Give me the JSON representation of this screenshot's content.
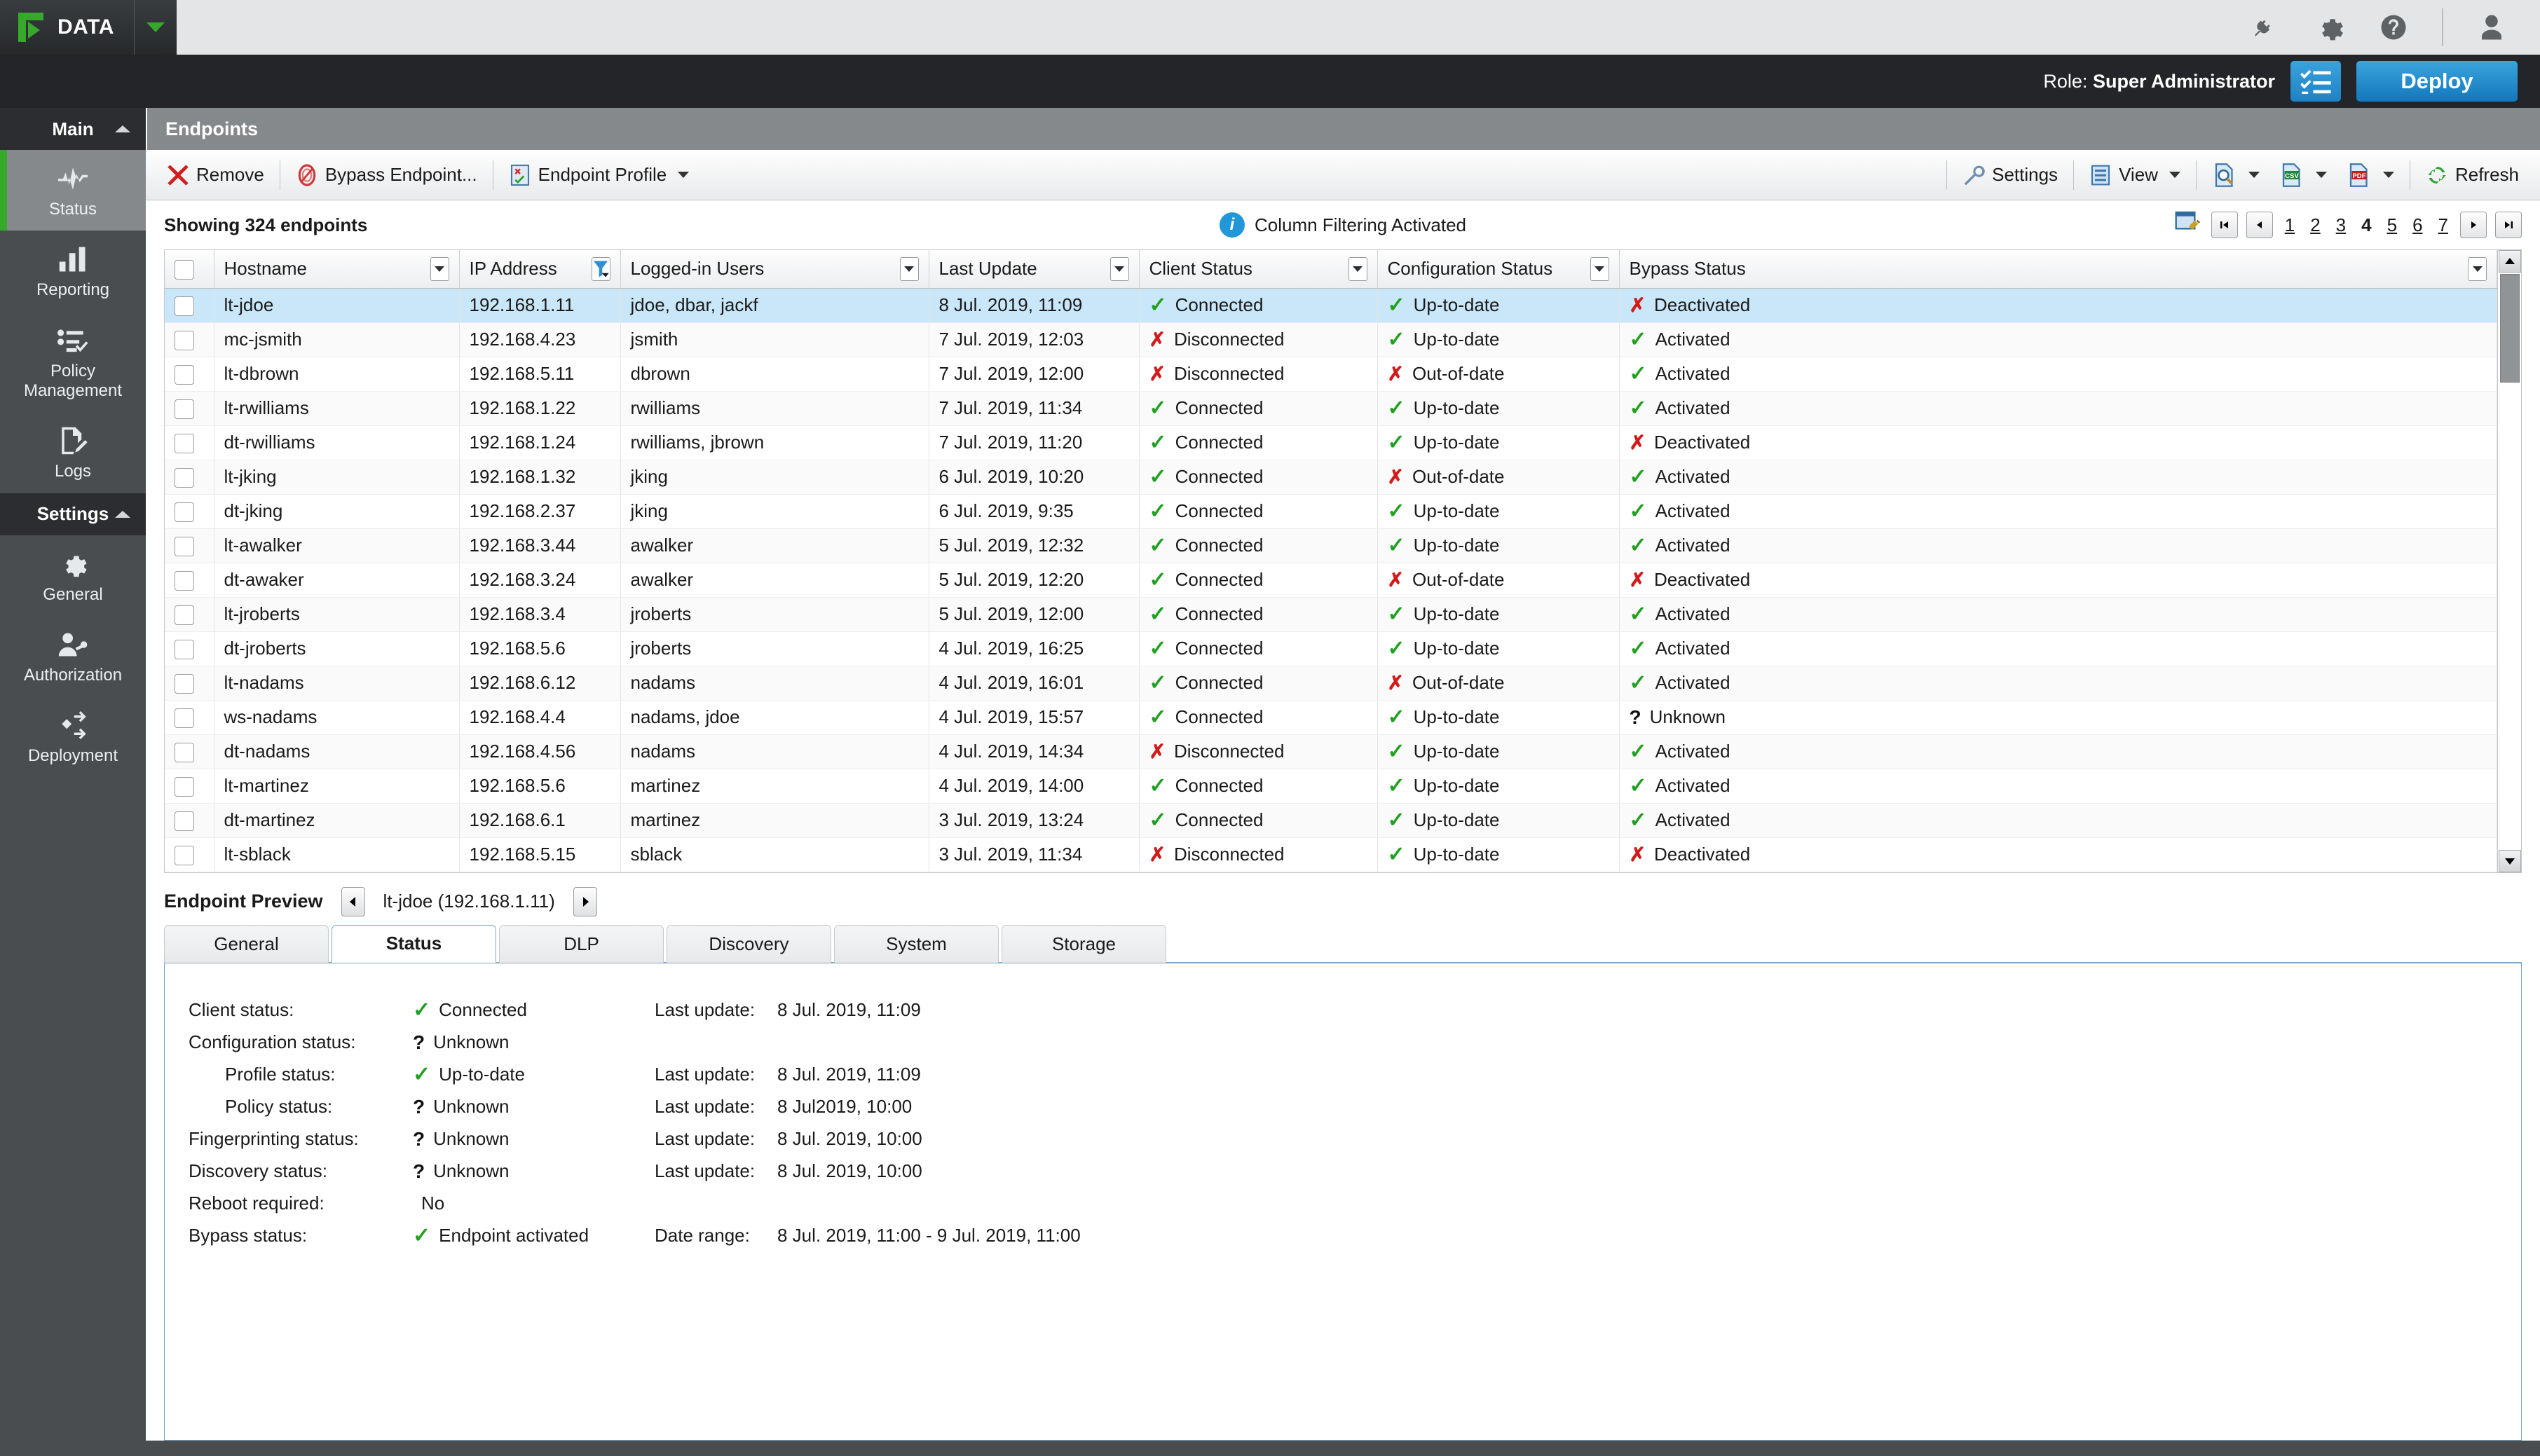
{
  "brand": {
    "name": "DATA",
    "logo_icon": "play-corner-logo",
    "caret_icon": "chevron-down-icon"
  },
  "topbar_icons": [
    {
      "name": "plugin-icon",
      "label": "Plugins"
    },
    {
      "name": "gear-icon",
      "label": "Settings"
    },
    {
      "name": "help-icon",
      "label": "Help"
    },
    {
      "name": "user-icon",
      "label": "Account"
    }
  ],
  "rolebar": {
    "role_prefix": "Role:",
    "role_value": "Super Administrator",
    "tasks_icon": "checklist-icon",
    "deploy_label": "Deploy",
    "accent": "#1d82c4"
  },
  "sidebar": {
    "groups": [
      {
        "label": "Main",
        "collapse_icon": "chevron-up-icon",
        "items": [
          {
            "label": "Status",
            "icon": "pulse-icon",
            "active": true
          },
          {
            "label": "Reporting",
            "icon": "bar-chart-icon",
            "active": false
          },
          {
            "label": "Policy Management",
            "icon": "checklist-icon",
            "active": false
          },
          {
            "label": "Logs",
            "icon": "document-pencil-icon",
            "active": false
          }
        ]
      },
      {
        "label": "Settings",
        "collapse_icon": "chevron-up-icon",
        "items": [
          {
            "label": "General",
            "icon": "gear-icon",
            "active": false
          },
          {
            "label": "Authorization",
            "icon": "user-key-icon",
            "active": false
          },
          {
            "label": "Deployment",
            "icon": "deployment-nodes-icon",
            "active": false
          }
        ]
      }
    ],
    "active_accent": "#36a82b"
  },
  "page": {
    "title": "Endpoints"
  },
  "toolbar": {
    "left": [
      {
        "label": "Remove",
        "icon": "red-x-icon"
      },
      {
        "label": "Bypass Endpoint...",
        "icon": "no-entry-icon"
      },
      {
        "label": "Endpoint Profile",
        "icon": "profile-doc-icon",
        "caret": true
      }
    ],
    "right": [
      {
        "label": "Settings",
        "icon": "wrench-icon"
      },
      {
        "label": "View",
        "icon": "list-view-icon",
        "caret": true
      },
      {
        "label": "",
        "icon": "preview-search-icon",
        "caret": true
      },
      {
        "label": "",
        "icon": "csv-export-icon",
        "caret": true
      },
      {
        "label": "",
        "icon": "pdf-export-icon",
        "caret": true
      },
      {
        "label": "Refresh",
        "icon": "refresh-icon"
      }
    ]
  },
  "info_row": {
    "showing": "Showing 324 endpoints",
    "column_filter_notice": "Column Filtering Activated",
    "info_icon": "info-icon",
    "grid_settings_icon": "grid-settings-icon"
  },
  "pagination": {
    "first_icon": "first-page-icon",
    "prev_icon": "prev-page-icon",
    "next_icon": "next-page-icon",
    "last_icon": "last-page-icon",
    "pages": [
      "1",
      "2",
      "3",
      "4",
      "5",
      "6",
      "7"
    ],
    "current": "4"
  },
  "table": {
    "columns": [
      {
        "key": "check",
        "label": "",
        "filter": "none"
      },
      {
        "key": "host",
        "label": "Hostname",
        "filter": "dropdown"
      },
      {
        "key": "ip",
        "label": "IP Address",
        "filter": "funnel-active"
      },
      {
        "key": "users",
        "label": "Logged-in Users",
        "filter": "dropdown"
      },
      {
        "key": "update",
        "label": "Last Update",
        "filter": "dropdown"
      },
      {
        "key": "client",
        "label": "Client Status",
        "filter": "dropdown"
      },
      {
        "key": "config",
        "label": "Configuration Status",
        "filter": "dropdown"
      },
      {
        "key": "bypass",
        "label": "Bypass Status",
        "filter": "dropdown"
      }
    ],
    "rows": [
      {
        "host": "lt-jdoe",
        "ip": "192.168.1.11",
        "users": "jdoe, dbar, jackf",
        "update": "8 Jul. 2019, 11:09",
        "client": {
          "t": "Connected",
          "s": "ok"
        },
        "config": {
          "t": "Up-to-date",
          "s": "ok"
        },
        "bypass": {
          "t": "Deactivated",
          "s": "bad"
        },
        "selected": true
      },
      {
        "host": "mc-jsmith",
        "ip": "192.168.4.23",
        "users": "jsmith",
        "update": "7 Jul. 2019, 12:03",
        "client": {
          "t": "Disconnected",
          "s": "bad"
        },
        "config": {
          "t": "Up-to-date",
          "s": "ok"
        },
        "bypass": {
          "t": "Activated",
          "s": "ok"
        }
      },
      {
        "host": "lt-dbrown",
        "ip": "192.168.5.11",
        "users": "dbrown",
        "update": "7 Jul. 2019, 12:00",
        "client": {
          "t": "Disconnected",
          "s": "bad"
        },
        "config": {
          "t": "Out-of-date",
          "s": "bad"
        },
        "bypass": {
          "t": "Activated",
          "s": "ok"
        }
      },
      {
        "host": "lt-rwilliams",
        "ip": "192.168.1.22",
        "users": "rwilliams",
        "update": "7 Jul. 2019, 11:34",
        "client": {
          "t": "Connected",
          "s": "ok"
        },
        "config": {
          "t": "Up-to-date",
          "s": "ok"
        },
        "bypass": {
          "t": "Activated",
          "s": "ok"
        }
      },
      {
        "host": "dt-rwilliams",
        "ip": "192.168.1.24",
        "users": "rwilliams, jbrown",
        "update": "7 Jul. 2019, 11:20",
        "client": {
          "t": "Connected",
          "s": "ok"
        },
        "config": {
          "t": "Up-to-date",
          "s": "ok"
        },
        "bypass": {
          "t": "Deactivated",
          "s": "bad"
        }
      },
      {
        "host": "lt-jking",
        "ip": "192.168.1.32",
        "users": "jking",
        "update": "6 Jul. 2019, 10:20",
        "client": {
          "t": "Connected",
          "s": "ok"
        },
        "config": {
          "t": "Out-of-date",
          "s": "bad"
        },
        "bypass": {
          "t": "Activated",
          "s": "ok"
        }
      },
      {
        "host": "dt-jking",
        "ip": "192.168.2.37",
        "users": "jking",
        "update": "6 Jul. 2019, 9:35",
        "client": {
          "t": "Connected",
          "s": "ok"
        },
        "config": {
          "t": "Up-to-date",
          "s": "ok"
        },
        "bypass": {
          "t": "Activated",
          "s": "ok"
        }
      },
      {
        "host": "lt-awalker",
        "ip": "192.168.3.44",
        "users": "awalker",
        "update": "5 Jul. 2019, 12:32",
        "client": {
          "t": "Connected",
          "s": "ok"
        },
        "config": {
          "t": "Up-to-date",
          "s": "ok"
        },
        "bypass": {
          "t": "Activated",
          "s": "ok"
        }
      },
      {
        "host": "dt-awaker",
        "ip": "192.168.3.24",
        "users": "awalker",
        "update": "5 Jul. 2019, 12:20",
        "client": {
          "t": "Connected",
          "s": "ok"
        },
        "config": {
          "t": "Out-of-date",
          "s": "bad"
        },
        "bypass": {
          "t": "Deactivated",
          "s": "bad"
        }
      },
      {
        "host": "lt-jroberts",
        "ip": "192.168.3.4",
        "users": "jroberts",
        "update": "5 Jul. 2019, 12:00",
        "client": {
          "t": "Connected",
          "s": "ok"
        },
        "config": {
          "t": "Up-to-date",
          "s": "ok"
        },
        "bypass": {
          "t": "Activated",
          "s": "ok"
        }
      },
      {
        "host": "dt-jroberts",
        "ip": "192.168.5.6",
        "users": "jroberts",
        "update": "4 Jul. 2019, 16:25",
        "client": {
          "t": "Connected",
          "s": "ok"
        },
        "config": {
          "t": "Up-to-date",
          "s": "ok"
        },
        "bypass": {
          "t": "Activated",
          "s": "ok"
        }
      },
      {
        "host": "lt-nadams",
        "ip": "192.168.6.12",
        "users": "nadams",
        "update": "4 Jul. 2019, 16:01",
        "client": {
          "t": "Connected",
          "s": "ok"
        },
        "config": {
          "t": "Out-of-date",
          "s": "bad"
        },
        "bypass": {
          "t": "Activated",
          "s": "ok"
        }
      },
      {
        "host": "ws-nadams",
        "ip": "192.168.4.4",
        "users": "nadams, jdoe",
        "update": "4 Jul. 2019, 15:57",
        "client": {
          "t": "Connected",
          "s": "ok"
        },
        "config": {
          "t": "Up-to-date",
          "s": "ok"
        },
        "bypass": {
          "t": "Unknown",
          "s": "unk"
        }
      },
      {
        "host": "dt-nadams",
        "ip": "192.168.4.56",
        "users": "nadams",
        "update": "4 Jul. 2019, 14:34",
        "client": {
          "t": "Disconnected",
          "s": "bad"
        },
        "config": {
          "t": "Up-to-date",
          "s": "ok"
        },
        "bypass": {
          "t": "Activated",
          "s": "ok"
        }
      },
      {
        "host": "lt-martinez",
        "ip": "192.168.5.6",
        "users": "martinez",
        "update": "4 Jul. 2019, 14:00",
        "client": {
          "t": "Connected",
          "s": "ok"
        },
        "config": {
          "t": "Up-to-date",
          "s": "ok"
        },
        "bypass": {
          "t": "Activated",
          "s": "ok"
        }
      },
      {
        "host": "dt-martinez",
        "ip": "192.168.6.1",
        "users": "martinez",
        "update": "3 Jul. 2019, 13:24",
        "client": {
          "t": "Connected",
          "s": "ok"
        },
        "config": {
          "t": "Up-to-date",
          "s": "ok"
        },
        "bypass": {
          "t": "Activated",
          "s": "ok"
        }
      },
      {
        "host": "lt-sblack",
        "ip": "192.168.5.15",
        "users": "sblack",
        "update": "3 Jul. 2019, 11:34",
        "client": {
          "t": "Disconnected",
          "s": "bad"
        },
        "config": {
          "t": "Up-to-date",
          "s": "ok"
        },
        "bypass": {
          "t": "Deactivated",
          "s": "bad"
        }
      }
    ]
  },
  "preview": {
    "title": "Endpoint Preview",
    "prev_icon": "prev-endpoint-icon",
    "next_icon": "next-endpoint-icon",
    "endpoint_name": "lt-jdoe (192.168.1.11)",
    "tabs": [
      {
        "label": "General",
        "active": false
      },
      {
        "label": "Status",
        "active": true
      },
      {
        "label": "DLP",
        "active": false
      },
      {
        "label": "Discovery",
        "active": false
      },
      {
        "label": "System",
        "active": false
      },
      {
        "label": "Storage",
        "active": false
      }
    ],
    "details": [
      {
        "label": "Client status:",
        "value": "Connected",
        "status": "ok",
        "indent": false,
        "upd_label": "Last update:",
        "upd_value": "8 Jul. 2019, 11:09"
      },
      {
        "label": "Configuration status:",
        "value": "Unknown",
        "status": "unk",
        "indent": false,
        "upd_label": "",
        "upd_value": ""
      },
      {
        "label": "Profile status:",
        "value": "Up-to-date",
        "status": "ok",
        "indent": true,
        "upd_label": "Last update:",
        "upd_value": "8 Jul. 2019, 11:09"
      },
      {
        "label": "Policy status:",
        "value": "Unknown",
        "status": "unk",
        "indent": true,
        "upd_label": "Last update:",
        "upd_value": "8 Jul2019, 10:00"
      },
      {
        "label": "Fingerprinting status:",
        "value": "Unknown",
        "status": "unk",
        "indent": false,
        "upd_label": "Last update:",
        "upd_value": "8 Jul. 2019, 10:00"
      },
      {
        "label": "Discovery status:",
        "value": "Unknown",
        "status": "unk",
        "indent": false,
        "upd_label": "Last update:",
        "upd_value": "8 Jul. 2019, 10:00"
      },
      {
        "label": "Reboot required:",
        "value": "No",
        "status": "none",
        "indent": false,
        "upd_label": "",
        "upd_value": ""
      },
      {
        "label": "Bypass status:",
        "value": "Endpoint activated",
        "status": "ok",
        "indent": false,
        "upd_label": "Date range:",
        "upd_value": "8 Jul. 2019, 11:00 - 9 Jul. 2019, 11:00"
      }
    ]
  }
}
